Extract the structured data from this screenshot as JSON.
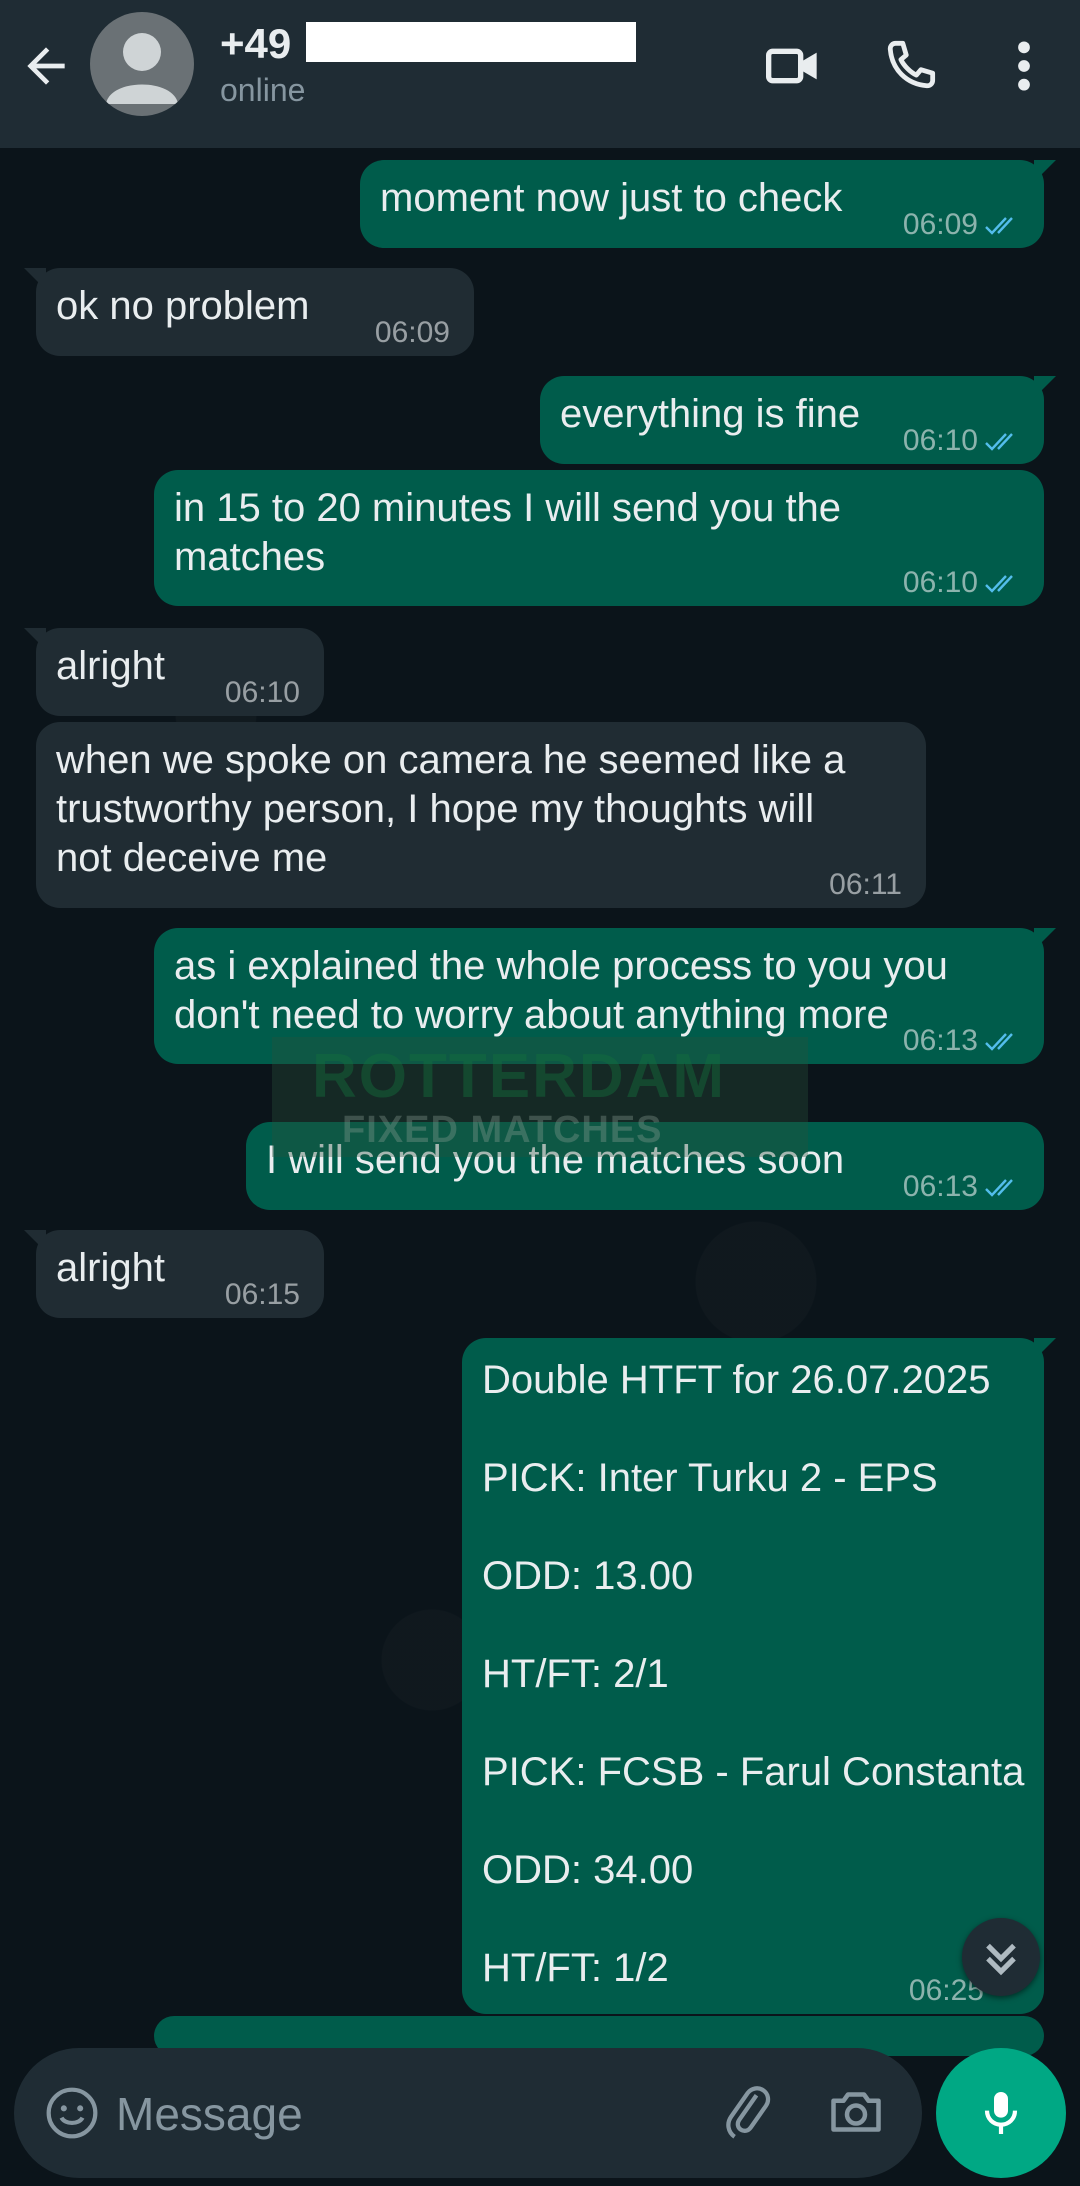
{
  "colors": {
    "header": "#1f2c34",
    "chat_bg": "#0b141a",
    "outgoing": "#005c4b",
    "incoming": "#202c33",
    "accent": "#00a884",
    "read_tick": "#53bdeb"
  },
  "header": {
    "contact_prefix": "+49",
    "status": "online",
    "icons": [
      "back-arrow-icon",
      "avatar",
      "video-call-icon",
      "phone-call-icon",
      "more-vert-icon"
    ]
  },
  "messages": [
    {
      "dir": "out",
      "text": "moment now just to check",
      "time": "06:09",
      "read": true
    },
    {
      "dir": "in",
      "text": "ok no problem",
      "time": "06:09"
    },
    {
      "dir": "out",
      "text": "everything is fine",
      "time": "06:10",
      "read": true
    },
    {
      "dir": "out",
      "text": "in 15 to 20 minutes I will send you the\nmatches",
      "time": "06:10",
      "read": true
    },
    {
      "dir": "in",
      "text": "alright",
      "time": "06:10"
    },
    {
      "dir": "in",
      "text": "when we spoke on camera he seemed like a\ntrustworthy person, I hope my thoughts will\nnot deceive me",
      "time": "06:11"
    },
    {
      "dir": "out",
      "text": "as i explained the whole process to you you\ndon't need to worry about anything more",
      "time": "06:13",
      "read": true
    },
    {
      "dir": "out",
      "text": "I will send you the matches soon",
      "time": "06:13",
      "read": true
    },
    {
      "dir": "in",
      "text": "alright",
      "time": "06:15"
    },
    {
      "dir": "out",
      "text": "Double HTFT for 26.07.2025\n\nPICK: Inter Turku 2 - EPS\n\nODD: 13.00\n\nHT/FT: 2/1\n\nPICK: FCSB - Farul Constanta\n\nODD: 34.00\n\nHT/FT: 1/2",
      "time": "06:25"
    }
  ],
  "watermark": {
    "line1": "ROTTERDAM",
    "line2": "FIXED MATCHES"
  },
  "input": {
    "placeholder": "Message",
    "value": ""
  },
  "input_icons": [
    "emoji-icon",
    "attach-icon",
    "camera-icon",
    "mic-icon",
    "scroll-down-icon"
  ]
}
